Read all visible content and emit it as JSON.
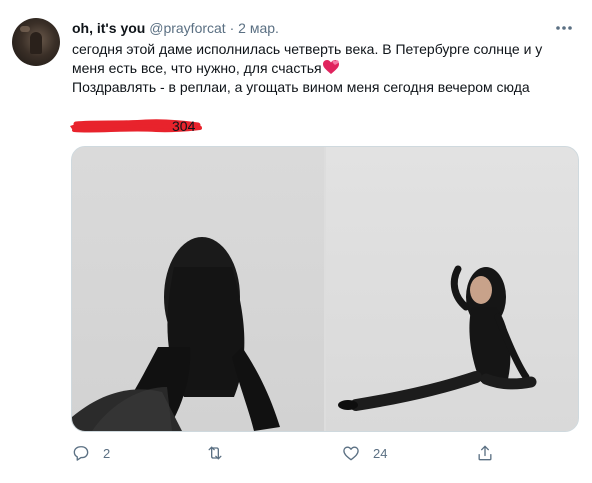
{
  "tweet": {
    "author_name": "oh, it's you",
    "handle": "@prayforcat",
    "separator": "·",
    "date": "2 мар.",
    "text_line1": "сегодня этой даме исполнилась четверть века. В Петербурге солнце и у",
    "text_line2": "меня есть все, что нужно, для счастья",
    "text_line3": "Поздравлять - в реплаи, а угощать вином меня сегодня вечером сюда",
    "redacted_suffix": "304"
  },
  "actions": {
    "reply_count": "2",
    "retweet_count": "",
    "like_count": "24"
  },
  "icons": {
    "more": "more-horizontal-icon",
    "reply": "reply-icon",
    "retweet": "retweet-icon",
    "like": "heart-outline-icon",
    "share": "share-icon",
    "emoji": "two-hearts-icon"
  },
  "colors": {
    "secondary_text": "#5b7083",
    "redaction": "#e8232c",
    "heart_emoji": "#e0245e"
  }
}
